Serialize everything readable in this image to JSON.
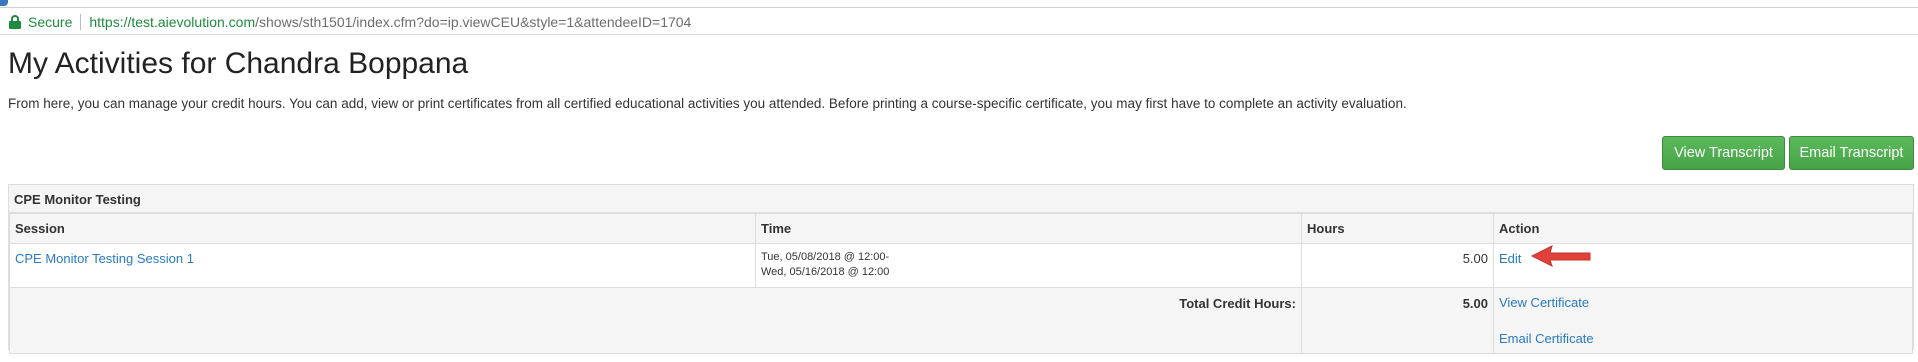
{
  "browser": {
    "secure_label": "Secure",
    "url_host": "https://test.aievolution.com",
    "url_rest": "/shows/sth1501/index.cfm?do=ip.viewCEU&style=1&attendeeID=1704"
  },
  "page": {
    "title": "My Activities for Chandra Boppana",
    "intro": "From here, you can manage your credit hours. You can add, view or print certificates from all certified educational activities you attended. Before printing a course-specific certificate, you may first have to complete an activity evaluation."
  },
  "buttons": {
    "view_transcript": "View Transcript",
    "email_transcript": "Email Transcript"
  },
  "panel": {
    "heading": "CPE Monitor Testing",
    "columns": [
      "Session",
      "Time",
      "Hours",
      "Action"
    ],
    "rows": [
      {
        "session": "CPE Monitor Testing Session 1",
        "time_start": "Tue, 05/08/2018 @ 12:00-",
        "time_end": "Wed, 05/16/2018 @ 12:00",
        "hours": "5.00",
        "action": "Edit"
      }
    ],
    "total": {
      "label": "Total Credit Hours:",
      "hours": "5.00",
      "view_certificate": "View Certificate",
      "email_certificate": "Email Certificate"
    }
  },
  "colors": {
    "secure_green": "#1e8b3f",
    "button_green": "#4cae4c",
    "link_blue": "#2a7ac0",
    "annotation_arrow": "#e0413a"
  },
  "icons": [
    "lock-icon",
    "annotation-arrow-icon"
  ]
}
